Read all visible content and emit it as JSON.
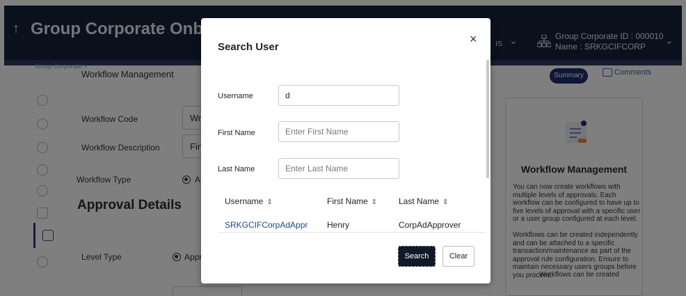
{
  "header": {
    "back_icon": "arrow-up-icon",
    "title": "Group Corporate Onboardi",
    "right_fragment": "ıs",
    "group_id": "Group Corporate ID : 000010",
    "group_name": "Name : SRKGCIFCORP",
    "org_icon": "org-chart-icon"
  },
  "breadcrumb": {
    "parent": "Group Corporate >",
    "current": "Workflow Management"
  },
  "actions": {
    "summary": "Summary",
    "comments": "Comments"
  },
  "rail": {
    "icons": [
      "globe-icon",
      "globe-settings-icon",
      "badge-icon",
      "users-icon",
      "clock-icon",
      "building-icon",
      "workflow-icon",
      "settings-icon"
    ]
  },
  "form": {
    "workflow_code_label": "Workflow Code",
    "workflow_code_value": "Wri",
    "workflow_description_label": "Workflow Description",
    "workflow_description_value": "Fin",
    "workflow_type_label": "Workflow Type",
    "workflow_type_option": "A",
    "approval_details_title": "Approval Details",
    "level_type_label": "Level Type",
    "level_type_option": "Appr"
  },
  "info_panel": {
    "icon": "document-icon",
    "title": "Workflow Management",
    "paragraph1": "You can now create workflows with multiple levels of approvals. Each workflow can be configured to have up to five levels of approval with a specific user or a user group configured at each level.",
    "paragraph2": "Workflows can be created independently and can be attached to a specific transaction/maintenance as part of the approval rule configuration. Ensure to maintain necessary users groups before you proceed.",
    "paragraph3": "Workflows can be created"
  },
  "modal": {
    "title": "Search User",
    "close": "×",
    "username_label": "Username",
    "username_value": "d",
    "first_name_label": "First Name",
    "first_name_placeholder": "Enter First Name",
    "last_name_label": "Last Name",
    "last_name_placeholder": "Enter Last Name",
    "table": {
      "columns": [
        "Username",
        "First Name",
        "Last Name"
      ],
      "sort_icon": "⇕",
      "rows": [
        {
          "username": "SRKGCIFCorpAdAppr",
          "first_name": "Henry",
          "last_name": "CorpAdApprover"
        }
      ]
    },
    "search_button": "Search",
    "clear_button": "Clear"
  }
}
